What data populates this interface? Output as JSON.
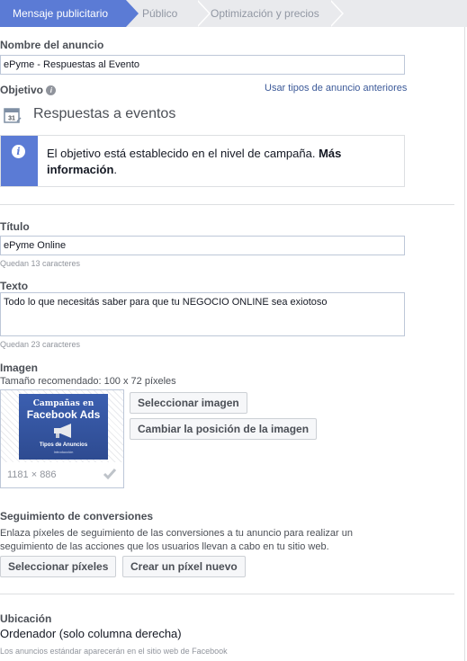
{
  "tabs": [
    {
      "label": "Mensaje publicitario"
    },
    {
      "label": "Público"
    },
    {
      "label": "Optimización y precios"
    }
  ],
  "ad_name": {
    "label": "Nombre del anuncio",
    "value": "ePyme - Respuestas al Evento"
  },
  "objective": {
    "label": "Objetivo",
    "link": "Usar tipos de anuncio anteriores",
    "value": "Respuestas a eventos",
    "icon": "calendar-icon",
    "notice_text": "El objetivo está establecido en el nivel de campaña.",
    "notice_link": "Más información"
  },
  "title_field": {
    "label": "Título",
    "value": "ePyme Online",
    "remaining": "Quedan 13 caracteres"
  },
  "text_field": {
    "label": "Texto",
    "value": "Todo lo que necesitás saber para que tu NEGOCIO ONLINE sea exiotoso",
    "remaining": "Quedan 23 caracteres"
  },
  "image": {
    "label": "Imagen",
    "recommended": "Tamaño recomendado: 100 x 72 píxeles",
    "thumb_line1": "Campañas en",
    "thumb_line2": "Facebook Ads",
    "thumb_line3": "Tipos de Anuncios",
    "thumb_line4": "Introducción",
    "dims": "1181 × 886",
    "select_button": "Seleccionar imagen",
    "reposition_button": "Cambiar la posición de la imagen"
  },
  "conversion": {
    "label": "Seguimiento de conversiones",
    "description": "Enlaza píxeles de seguimiento de las conversiones a tu anuncio para realizar un seguimiento de las acciones que los usuarios llevan a cabo en tu sitio web.",
    "select_button": "Seleccionar píxeles",
    "create_button": "Crear un píxel nuevo"
  },
  "placement": {
    "label": "Ubicación",
    "value": "Ordenador (solo columna derecha)",
    "hint": "Los anuncios estándar aparecerán en el sitio web de Facebook"
  },
  "colors": {
    "accent": "#5b7bd5",
    "link": "#3b5998"
  }
}
